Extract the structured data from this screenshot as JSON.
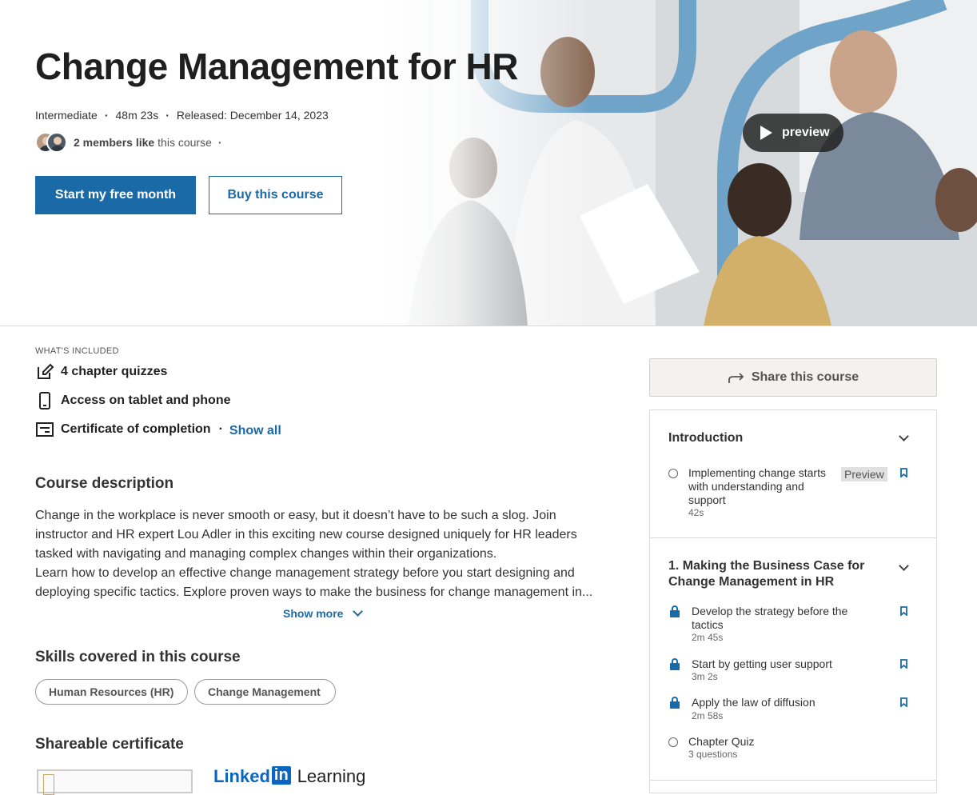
{
  "hero": {
    "title": "Change Management for HR",
    "meta": [
      "Intermediate",
      "48m 23s",
      "Released: December 14, 2023"
    ],
    "likes_bold": "2 members like",
    "likes_rest": "this course",
    "primary_button": "Start my free month",
    "secondary_button": "Buy this course",
    "preview_label": "preview"
  },
  "included": {
    "label": "WHAT'S INCLUDED",
    "items": [
      {
        "label": "4 chapter quizzes",
        "icon": "edit-icon"
      },
      {
        "label": "Access on tablet and phone",
        "icon": "phone-icon"
      },
      {
        "label": "Certificate of completion",
        "icon": "certificate-icon"
      }
    ],
    "show_all": "Show all"
  },
  "description": {
    "heading": "Course description",
    "lines": [
      "Change in the workplace is never smooth or easy, but it doesn’t have to be such a slog. Join",
      "instructor and HR expert Lou Adler in this exciting new course designed uniquely for HR leaders",
      "tasked with navigating and managing complex changes within their organizations.",
      "Learn how to develop an effective change management strategy before you start designing and",
      "deploying specific tactics. Explore proven ways to make the business for change management in..."
    ],
    "show_more": "Show more"
  },
  "skills": {
    "heading": "Skills covered in this course",
    "items": [
      "Human Resources (HR)",
      "Change Management"
    ]
  },
  "certificate": {
    "heading": "Shareable certificate",
    "logo_linked": "Linked",
    "logo_in": "in",
    "logo_learning": "Learning"
  },
  "share": {
    "label": "Share this course"
  },
  "toc": {
    "sections": [
      {
        "title": "Introduction",
        "items": [
          {
            "name": "Implementing change starts with understanding and support",
            "duration": "42s",
            "badge": "Preview",
            "locked": false
          }
        ]
      },
      {
        "title": "1. Making the Business Case for Change Management in HR",
        "items": [
          {
            "name": "Develop the strategy before the tactics",
            "duration": "2m 45s",
            "locked": true
          },
          {
            "name": "Start by getting user support",
            "duration": "3m 2s",
            "locked": true
          },
          {
            "name": "Apply the law of diffusion",
            "duration": "2m 58s",
            "locked": true
          },
          {
            "name": "Chapter Quiz",
            "duration": "3 questions",
            "locked": false
          }
        ]
      }
    ]
  },
  "colors": {
    "accent": "#1a6aa8",
    "text": "#1f1f1f",
    "muted": "#555555"
  }
}
